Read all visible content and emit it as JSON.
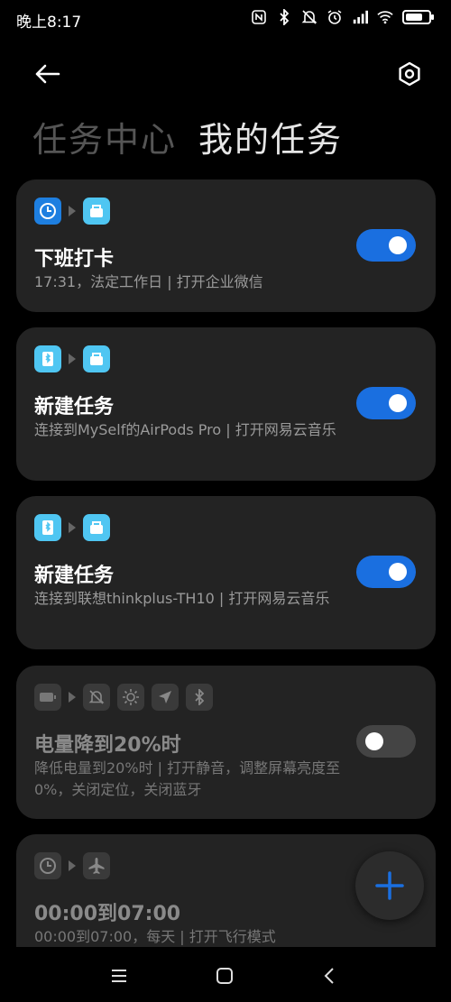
{
  "status_bar": {
    "time": "晚上8:17",
    "battery_level": 0.75
  },
  "header": {
    "back_icon": "arrow-left-icon",
    "settings_icon": "gear-icon"
  },
  "tabs": [
    {
      "label": "任务中心",
      "active": false
    },
    {
      "label": "我的任务",
      "active": true
    }
  ],
  "tasks": [
    {
      "trigger_icons": [
        "clock-icon"
      ],
      "action_icons": [
        "wecom-app-icon"
      ],
      "title": "下班打卡",
      "description": "17:31，法定工作日 | 打开企业微信",
      "enabled": true
    },
    {
      "trigger_icons": [
        "bluetooth-device-icon"
      ],
      "action_icons": [
        "music-app-icon"
      ],
      "title": "新建任务",
      "description": "连接到MySelf的AirPods Pro | 打开网易云音乐",
      "enabled": true
    },
    {
      "trigger_icons": [
        "bluetooth-device-icon"
      ],
      "action_icons": [
        "music-app-icon"
      ],
      "title": "新建任务",
      "description": "连接到联想thinkplus-TH10 | 打开网易云音乐",
      "enabled": true
    },
    {
      "trigger_icons": [
        "battery-icon"
      ],
      "action_icons": [
        "mute-icon",
        "brightness-icon",
        "location-icon",
        "bluetooth-icon"
      ],
      "title": "电量降到20%时",
      "description": "降低电量到20%时 | 打开静音，调整屏幕亮度至0%，关闭定位，关闭蓝牙",
      "enabled": false
    },
    {
      "trigger_icons": [
        "clock-icon"
      ],
      "action_icons": [
        "airplane-icon"
      ],
      "title": "00:00到07:00",
      "description": "00:00到07:00，每天 | 打开飞行模式",
      "enabled": false
    }
  ],
  "fab": {
    "icon": "plus-icon"
  },
  "navbar": {
    "items": [
      "menu-icon",
      "home-icon",
      "back-icon"
    ]
  },
  "colors": {
    "accent": "#1a6fe0",
    "card_bg": "#232323",
    "background": "#000000"
  }
}
